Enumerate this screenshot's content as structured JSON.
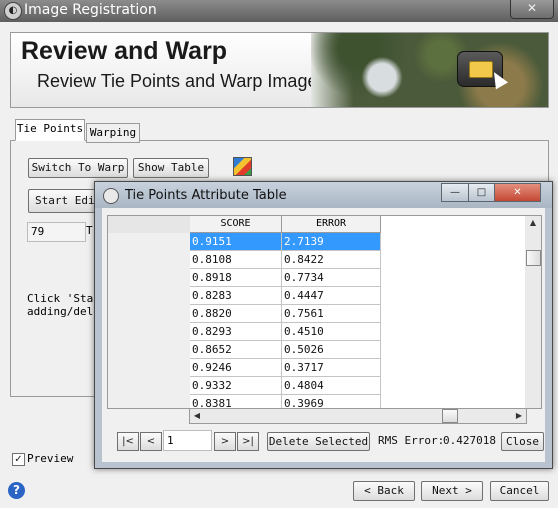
{
  "window": {
    "title": "Image Registration",
    "close_glyph": "✕"
  },
  "header": {
    "title": "Review and Warp",
    "subtitle": "Review Tie Points and Warp Image"
  },
  "tabs": [
    {
      "label": "Tie Points"
    },
    {
      "label": "Warping"
    }
  ],
  "tie_points_tab": {
    "switch_to_warp": "Switch To Warp",
    "show_table": "Show Table",
    "start_editing": "Start Edit",
    "count_value": "79",
    "count_label": "T",
    "instruction": "Click 'Star\nadding/dele"
  },
  "preview": {
    "label": "Preview",
    "checked": true,
    "check_glyph": "✓"
  },
  "footer": {
    "help_glyph": "?",
    "back": "< Back",
    "next": "Next >",
    "cancel": "Cancel"
  },
  "dialog": {
    "title": "Tie Points Attribute Table",
    "min_glyph": "—",
    "max_glyph": "□",
    "close_glyph": "✕",
    "columns": [
      "SCORE",
      "ERROR"
    ],
    "rows": [
      {
        "score": "0.9151",
        "error": "2.7139",
        "selected": true
      },
      {
        "score": "0.8108",
        "error": "0.8422"
      },
      {
        "score": "0.8918",
        "error": "0.7734"
      },
      {
        "score": "0.8283",
        "error": "0.4447"
      },
      {
        "score": "0.8820",
        "error": "0.7561"
      },
      {
        "score": "0.8293",
        "error": "0.4510"
      },
      {
        "score": "0.8652",
        "error": "0.5026"
      },
      {
        "score": "0.9246",
        "error": "0.3717"
      },
      {
        "score": "0.9332",
        "error": "0.4804"
      },
      {
        "score": "0.8381",
        "error": "0.3969"
      }
    ],
    "nav": {
      "first": "|<",
      "prev": "<",
      "record": "1",
      "next": ">",
      "last": ">|"
    },
    "delete_selected": "Delete Selected",
    "rms_label": "RMS Error:",
    "rms_value": "0.427018",
    "close_button": "Close"
  },
  "colors": {
    "selection": "#3399ff",
    "accent": "#2a64c5"
  }
}
